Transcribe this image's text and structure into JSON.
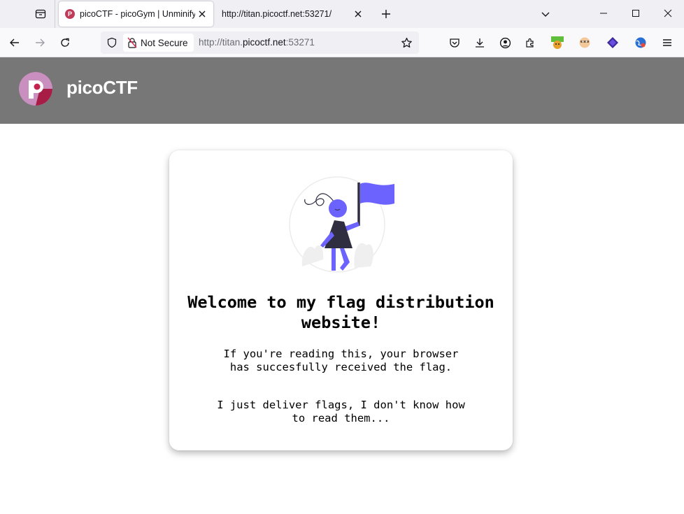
{
  "browser": {
    "tabs": [
      {
        "title": "picoCTF - picoGym | Unminify Ch",
        "favicon": "picoctf-favicon",
        "active": true
      },
      {
        "title": "http://titan.picoctf.net:53271/",
        "active": false
      }
    ],
    "security_label": "Not Secure",
    "url": {
      "prefix": "http://titan.",
      "host": "picoctf.net",
      "suffix": ":53271"
    },
    "toolbar_icons": [
      "pocket-icon",
      "downloads-icon",
      "account-icon",
      "extensions-icon",
      "extension-1-icon",
      "extension-2-icon",
      "extension-3-icon",
      "extension-4-icon",
      "menu-icon"
    ]
  },
  "site": {
    "brand": "picoCTF",
    "header_color": "#777777"
  },
  "card": {
    "heading": "Welcome to my flag distribution website!",
    "paragraph1": "If you're reading this, your browser has succesfully received the flag.",
    "paragraph2": "I just deliver flags, I don't know how to read them...",
    "accent_color": "#6c63ff"
  }
}
